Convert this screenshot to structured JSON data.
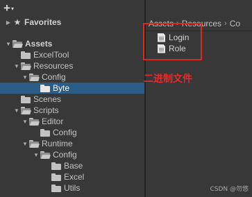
{
  "toolbar": {
    "add_symbol": "+",
    "add_caret": "▾"
  },
  "tree": [
    {
      "label": "Favorites",
      "arrow": "▶",
      "icon": "star",
      "bold": true
    },
    {
      "label": "Assets",
      "arrow": "▼",
      "icon": "folder-open",
      "bold": true
    },
    {
      "label": "ExcelTool",
      "arrow": "",
      "icon": "folder"
    },
    {
      "label": "Resources",
      "arrow": "▼",
      "icon": "folder-open"
    },
    {
      "label": "Config",
      "arrow": "▼",
      "icon": "folder-open"
    },
    {
      "label": "Byte",
      "arrow": "",
      "icon": "folder",
      "selected": true
    },
    {
      "label": "Scenes",
      "arrow": "",
      "icon": "folder"
    },
    {
      "label": "Scripts",
      "arrow": "▼",
      "icon": "folder-open"
    },
    {
      "label": "Editor",
      "arrow": "▼",
      "icon": "folder-open"
    },
    {
      "label": "Config",
      "arrow": "",
      "icon": "folder"
    },
    {
      "label": "Runtime",
      "arrow": "▼",
      "icon": "folder-open"
    },
    {
      "label": "Config",
      "arrow": "▼",
      "icon": "folder-open"
    },
    {
      "label": "Base",
      "arrow": "",
      "icon": "folder"
    },
    {
      "label": "Excel",
      "arrow": "",
      "icon": "folder"
    },
    {
      "label": "Utils",
      "arrow": "",
      "icon": "folder"
    }
  ],
  "breadcrumb": {
    "items": [
      "Assets",
      "Resources",
      "Co"
    ],
    "separator": "›"
  },
  "files": [
    {
      "label": "Login",
      "icon": "file-icon"
    },
    {
      "label": "Role",
      "icon": "file-icon"
    }
  ],
  "annotation": {
    "text": "二进制文件",
    "color": "#ee2727"
  },
  "watermark": {
    "text": "CSDN @勿悠"
  },
  "colors": {
    "selection": "#2c5d87",
    "panel": "#383838",
    "highlight_box": "#e0261d"
  }
}
